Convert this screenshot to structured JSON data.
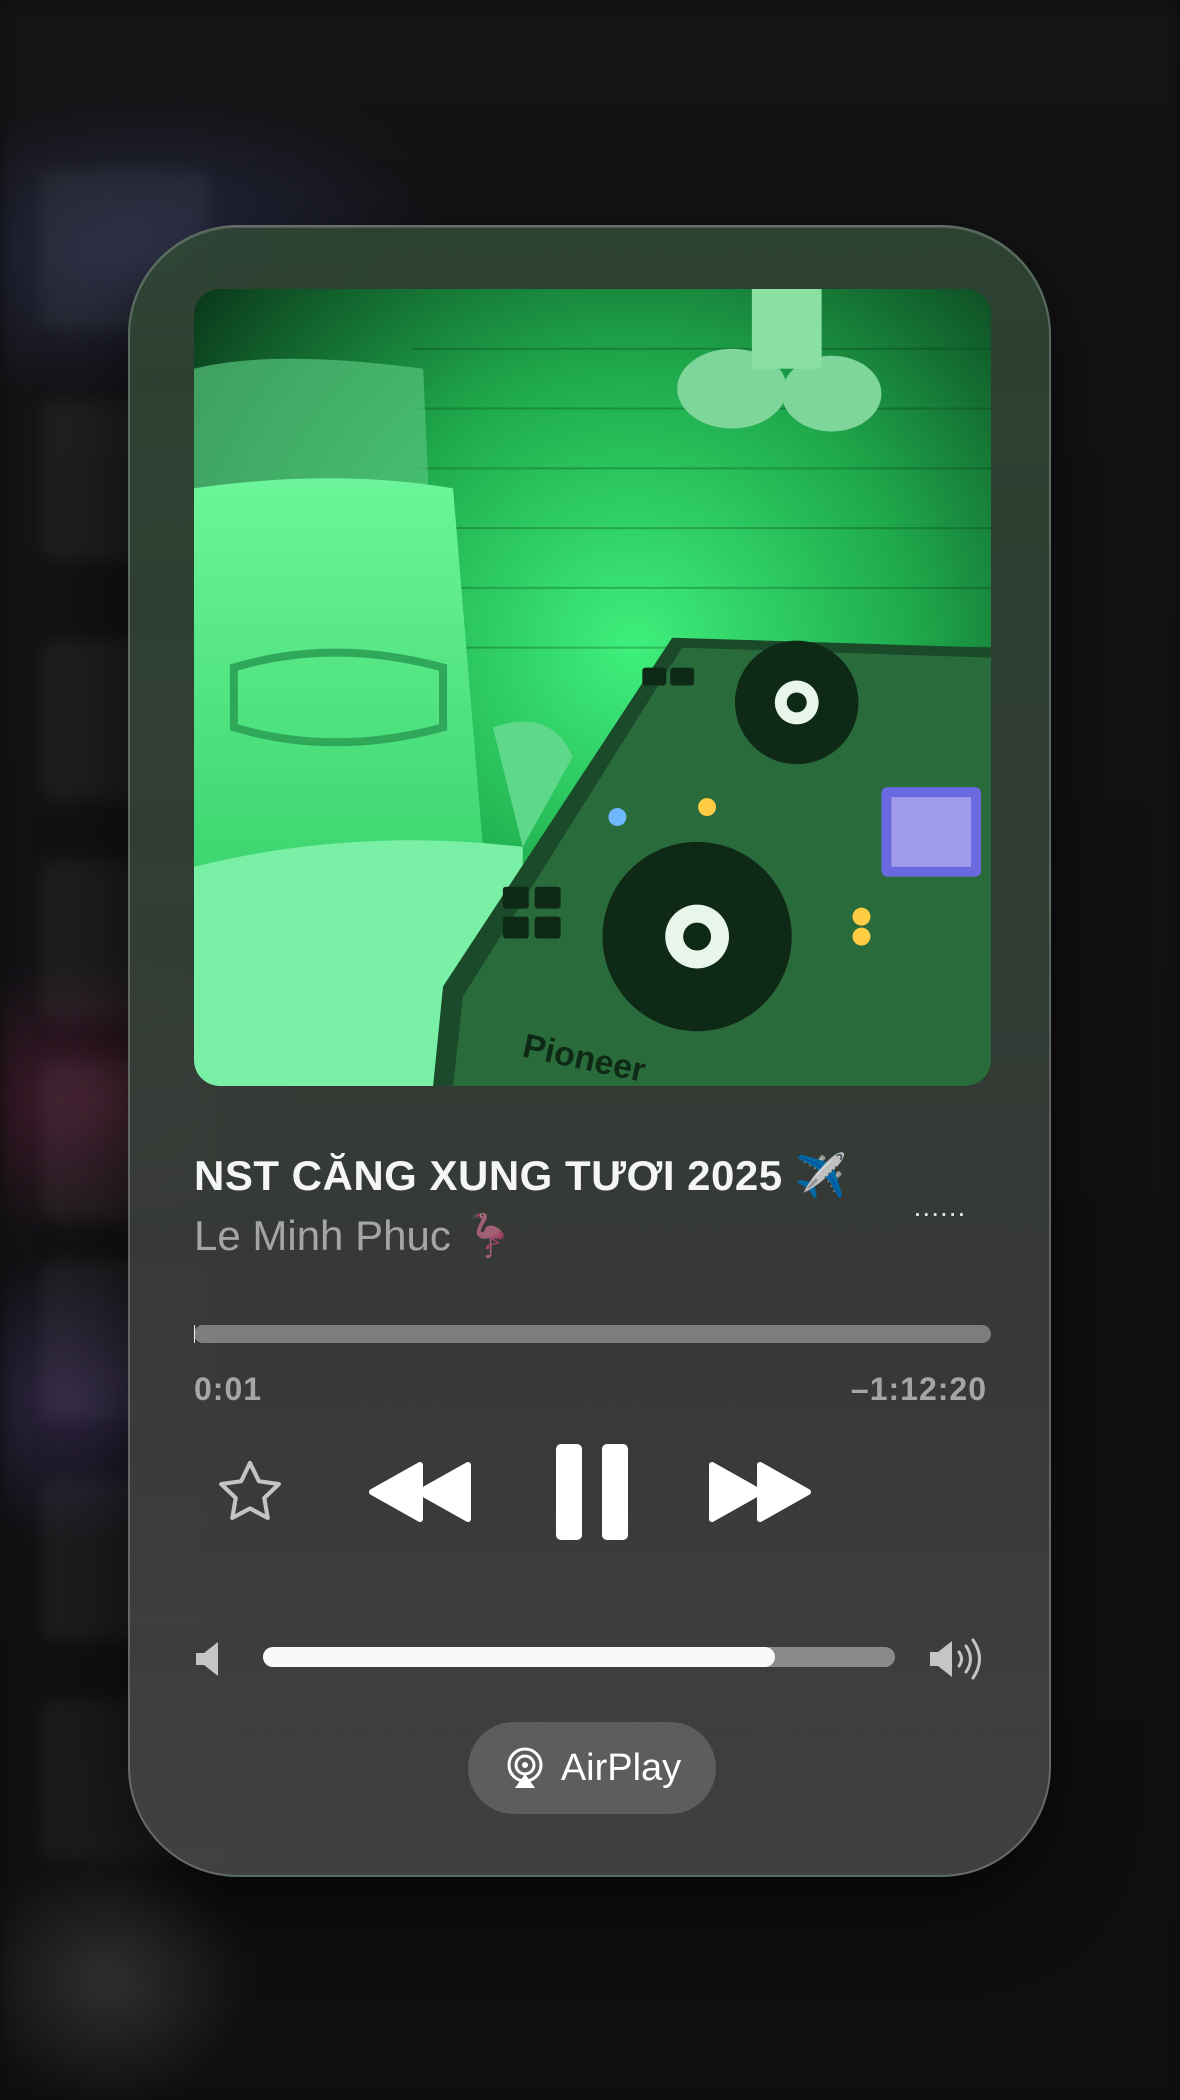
{
  "now_playing": {
    "title": "NST CĂNG XUNG TƯƠI 2025 ✈️",
    "artist": "Le Minh Phuc 🦩",
    "more_label": "......",
    "elapsed": "0:01",
    "remaining": "–1:12:20",
    "progress_fraction": 0.0002,
    "volume_fraction": 0.81,
    "is_playing": true
  },
  "controls": {
    "favorite_icon": "star-icon",
    "previous_icon": "rewind-icon",
    "pause_icon": "pause-icon",
    "next_icon": "fast-forward-icon"
  },
  "volume": {
    "low_icon": "speaker-low-icon",
    "high_icon": "speaker-high-icon"
  },
  "airplay": {
    "label": "AirPlay",
    "icon": "airplay-icon"
  },
  "colors": {
    "art_green": "#2ee06a",
    "card_top": "#2e4634",
    "card_bottom": "#444444"
  }
}
